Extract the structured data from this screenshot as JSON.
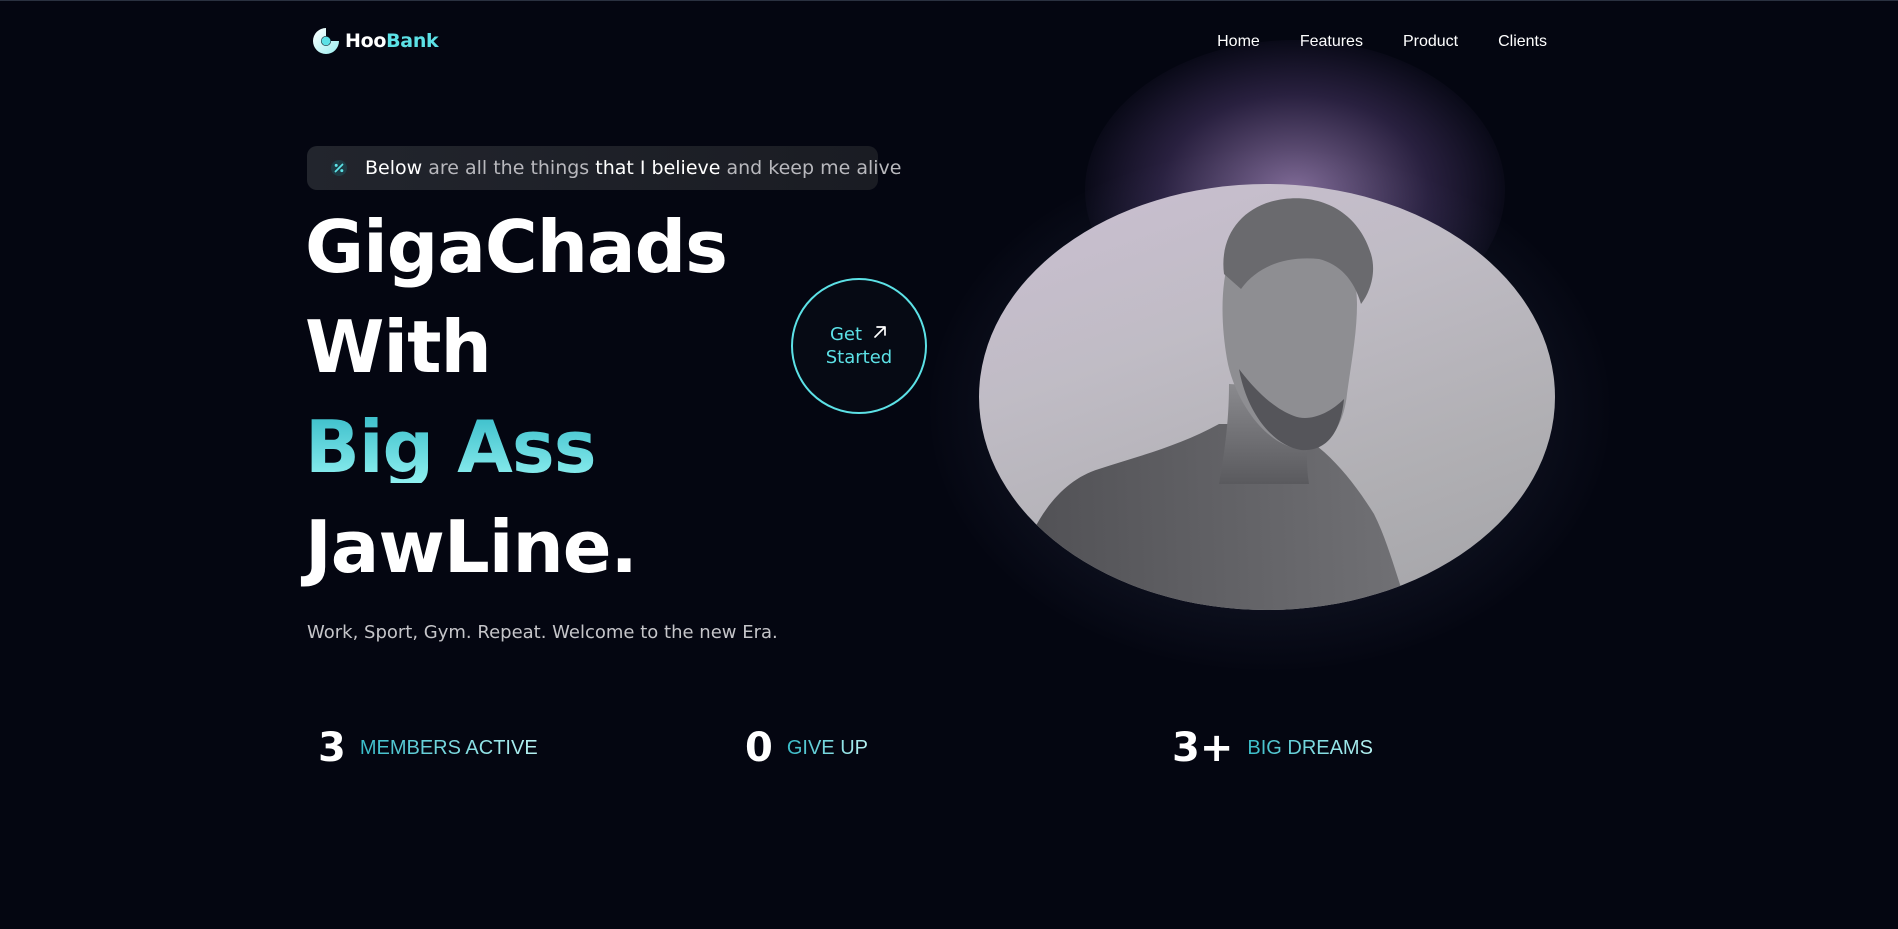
{
  "brand": {
    "name_part1": "Hoo",
    "name_part2": "Bank"
  },
  "nav": [
    {
      "label": "Home"
    },
    {
      "label": "Features"
    },
    {
      "label": "Product"
    },
    {
      "label": "Clients"
    }
  ],
  "badge": {
    "w1": "Below",
    "w2": " are all the things ",
    "w3": "that I believe",
    "w4": " and keep me alive"
  },
  "hero": {
    "line1": "GigaChads",
    "line2": "With",
    "line3": "Big Ass",
    "line4": "JawLine.",
    "subtitle": "Work, Sport, Gym. Repeat. Welcome to the new Era."
  },
  "cta": {
    "line1": "Get",
    "line2": "Started"
  },
  "stats": [
    {
      "value": "3",
      "label": "MEMBERS ACTIVE"
    },
    {
      "value": "0",
      "label": "GIVE UP"
    },
    {
      "value": "3+",
      "label": "BIG DREAMS"
    }
  ],
  "colors": {
    "accent": "#5ce1e6",
    "background": "#040611"
  }
}
